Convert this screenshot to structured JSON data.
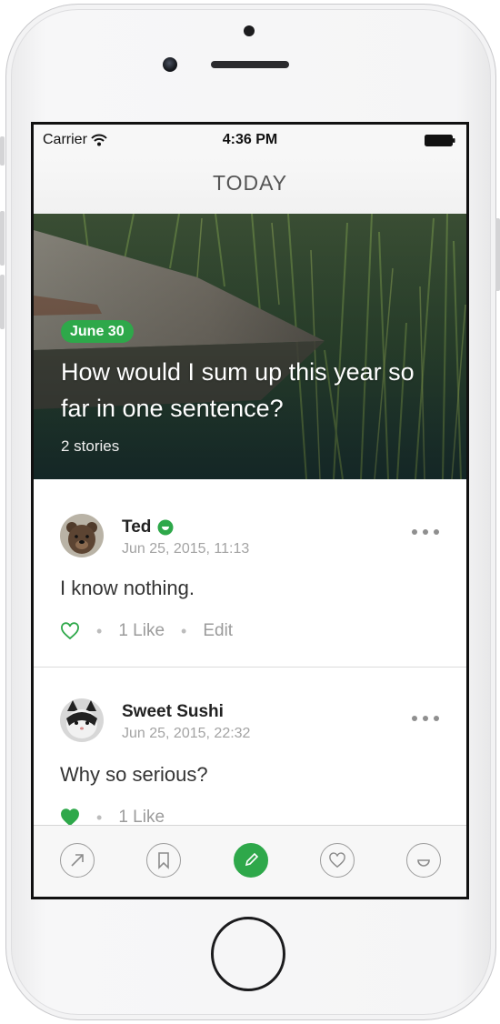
{
  "status_bar": {
    "carrier": "Carrier",
    "time": "4:36 PM"
  },
  "nav": {
    "title": "TODAY"
  },
  "hero": {
    "date": "June 30",
    "question": "How would I sum up this year so far in one sentence?",
    "story_count": "2 stories"
  },
  "stories": [
    {
      "author": "Ted",
      "timestamp": "Jun 25, 2015, 11:13",
      "text": "I know nothing.",
      "likes": "1 Like",
      "edit": "Edit",
      "liked": false
    },
    {
      "author": "Sweet Sushi",
      "timestamp": "Jun 25, 2015, 22:32",
      "text": "Why so serious?",
      "likes": "1 Like",
      "liked": true
    }
  ],
  "tabbar": {
    "items": [
      {
        "icon": "arrow-up-right-icon"
      },
      {
        "icon": "bookmark-icon"
      },
      {
        "icon": "pencil-icon",
        "active": true
      },
      {
        "icon": "heart-icon"
      },
      {
        "icon": "smile-icon"
      }
    ]
  },
  "colors": {
    "accent": "#2ea84a",
    "text_muted": "#a3a3a3"
  }
}
